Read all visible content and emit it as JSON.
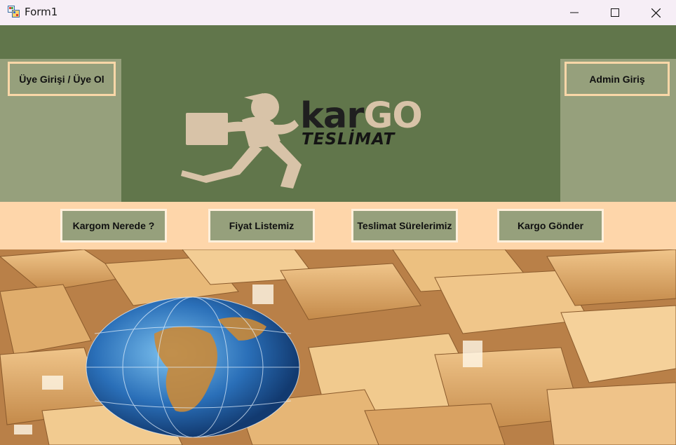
{
  "window": {
    "title": "Form1",
    "controls": {
      "minimize": "minimize-icon",
      "maximize": "maximize-icon",
      "close": "close-icon"
    }
  },
  "header": {
    "login_button": "Üye Girişi / Üye Ol",
    "admin_button": "Admin Giriş",
    "logo": {
      "brand_kar": "kar",
      "brand_go": "GO",
      "subtitle": "TESLİMAT"
    }
  },
  "nav": {
    "items": [
      {
        "label": "Kargom Nerede ?"
      },
      {
        "label": "Fiyat Listemiz"
      },
      {
        "label": "Teslimat Sürelerimiz"
      },
      {
        "label": "Kargo Gönder"
      }
    ]
  },
  "colors": {
    "title_bar": "#f6eef6",
    "header_green": "#61764b",
    "side_panel": "#96a07c",
    "nav_band": "#fed6aa",
    "button_border": "#fad7a8",
    "logo_figure": "#d8c3a8"
  }
}
